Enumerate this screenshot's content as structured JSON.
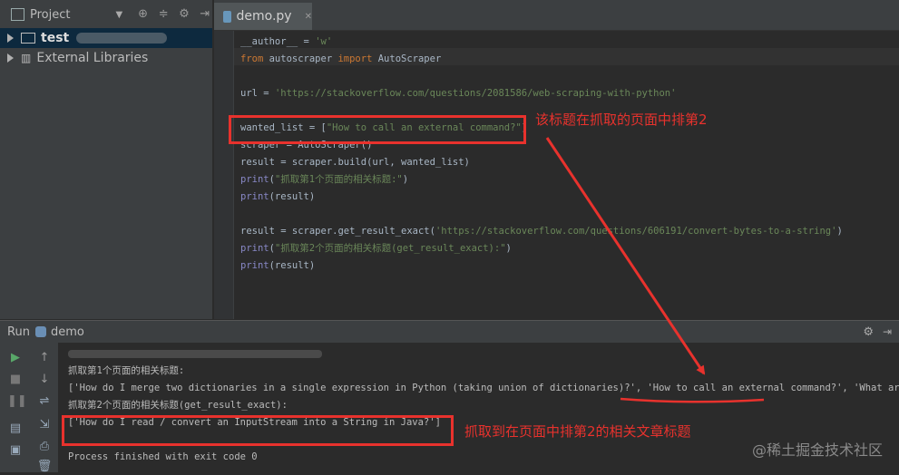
{
  "project_panel": {
    "title": "Project",
    "tree": [
      {
        "label": "test",
        "suffix": "(...)"
      },
      {
        "label": "External Libraries"
      }
    ]
  },
  "editor": {
    "tab": "demo.py",
    "lines": [
      {
        "parts": [
          [
            "dn",
            "__author__ = "
          ],
          [
            "st",
            "'w'"
          ]
        ]
      },
      {
        "parts": [
          [
            "kw",
            "from "
          ],
          [
            "dn",
            "autoscraper "
          ],
          [
            "kw",
            "import "
          ],
          [
            "dn",
            "AutoScraper"
          ]
        ]
      },
      {
        "parts": []
      },
      {
        "parts": [
          [
            "dn",
            "url = "
          ],
          [
            "st",
            "'https://stackoverflow.com/questions/2081586/web-scraping-with-python'"
          ]
        ]
      },
      {
        "parts": []
      },
      {
        "parts": [
          [
            "dn",
            "wanted_list = ["
          ],
          [
            "st",
            "\"How to call an external command?\""
          ],
          [
            "dn",
            "]"
          ]
        ]
      },
      {
        "parts": [
          [
            "dn",
            "scraper = AutoScraper()"
          ]
        ]
      },
      {
        "parts": [
          [
            "dn",
            "result = scraper.build(url, wanted_list)"
          ]
        ]
      },
      {
        "parts": [
          [
            "fn",
            "print"
          ],
          [
            "dn",
            "("
          ],
          [
            "st",
            "\"抓取第1个页面的相关标题:\""
          ],
          [
            "dn",
            ")"
          ]
        ]
      },
      {
        "parts": [
          [
            "fn",
            "print"
          ],
          [
            "dn",
            "(result)"
          ]
        ]
      },
      {
        "parts": []
      },
      {
        "parts": [
          [
            "dn",
            "result = scraper.get_result_exact("
          ],
          [
            "st",
            "'https://stackoverflow.com/questions/606191/convert-bytes-to-a-string'"
          ],
          [
            "dn",
            ")"
          ]
        ]
      },
      {
        "parts": [
          [
            "fn",
            "print"
          ],
          [
            "dn",
            "("
          ],
          [
            "st",
            "\"抓取第2个页面的相关标题(get_result_exact):\""
          ],
          [
            "dn",
            ")"
          ]
        ]
      },
      {
        "parts": [
          [
            "fn",
            "print"
          ],
          [
            "dn",
            "(result)"
          ]
        ]
      }
    ]
  },
  "run": {
    "title": "Run",
    "config": "demo",
    "output": [
      "",
      "抓取第1个页面的相关标题:",
      "['How do I merge two dictionaries in a single expression in Python (taking union of dictionaries)?', 'How to call an external command?', 'What are metac",
      "抓取第2个页面的相关标题(get_result_exact):",
      "['How do I read / convert an InputStream into a String in Java?']",
      "",
      "Process finished with exit code 0"
    ]
  },
  "annotations": {
    "note1": "该标题在抓取的页面中排第2",
    "note2": "抓取到在页面中排第2的相关文章标题"
  },
  "watermark": "@稀土掘金技术社区",
  "colors": {
    "annotation": "#e8322d",
    "keyword": "#cc7832",
    "string": "#6a8759"
  }
}
